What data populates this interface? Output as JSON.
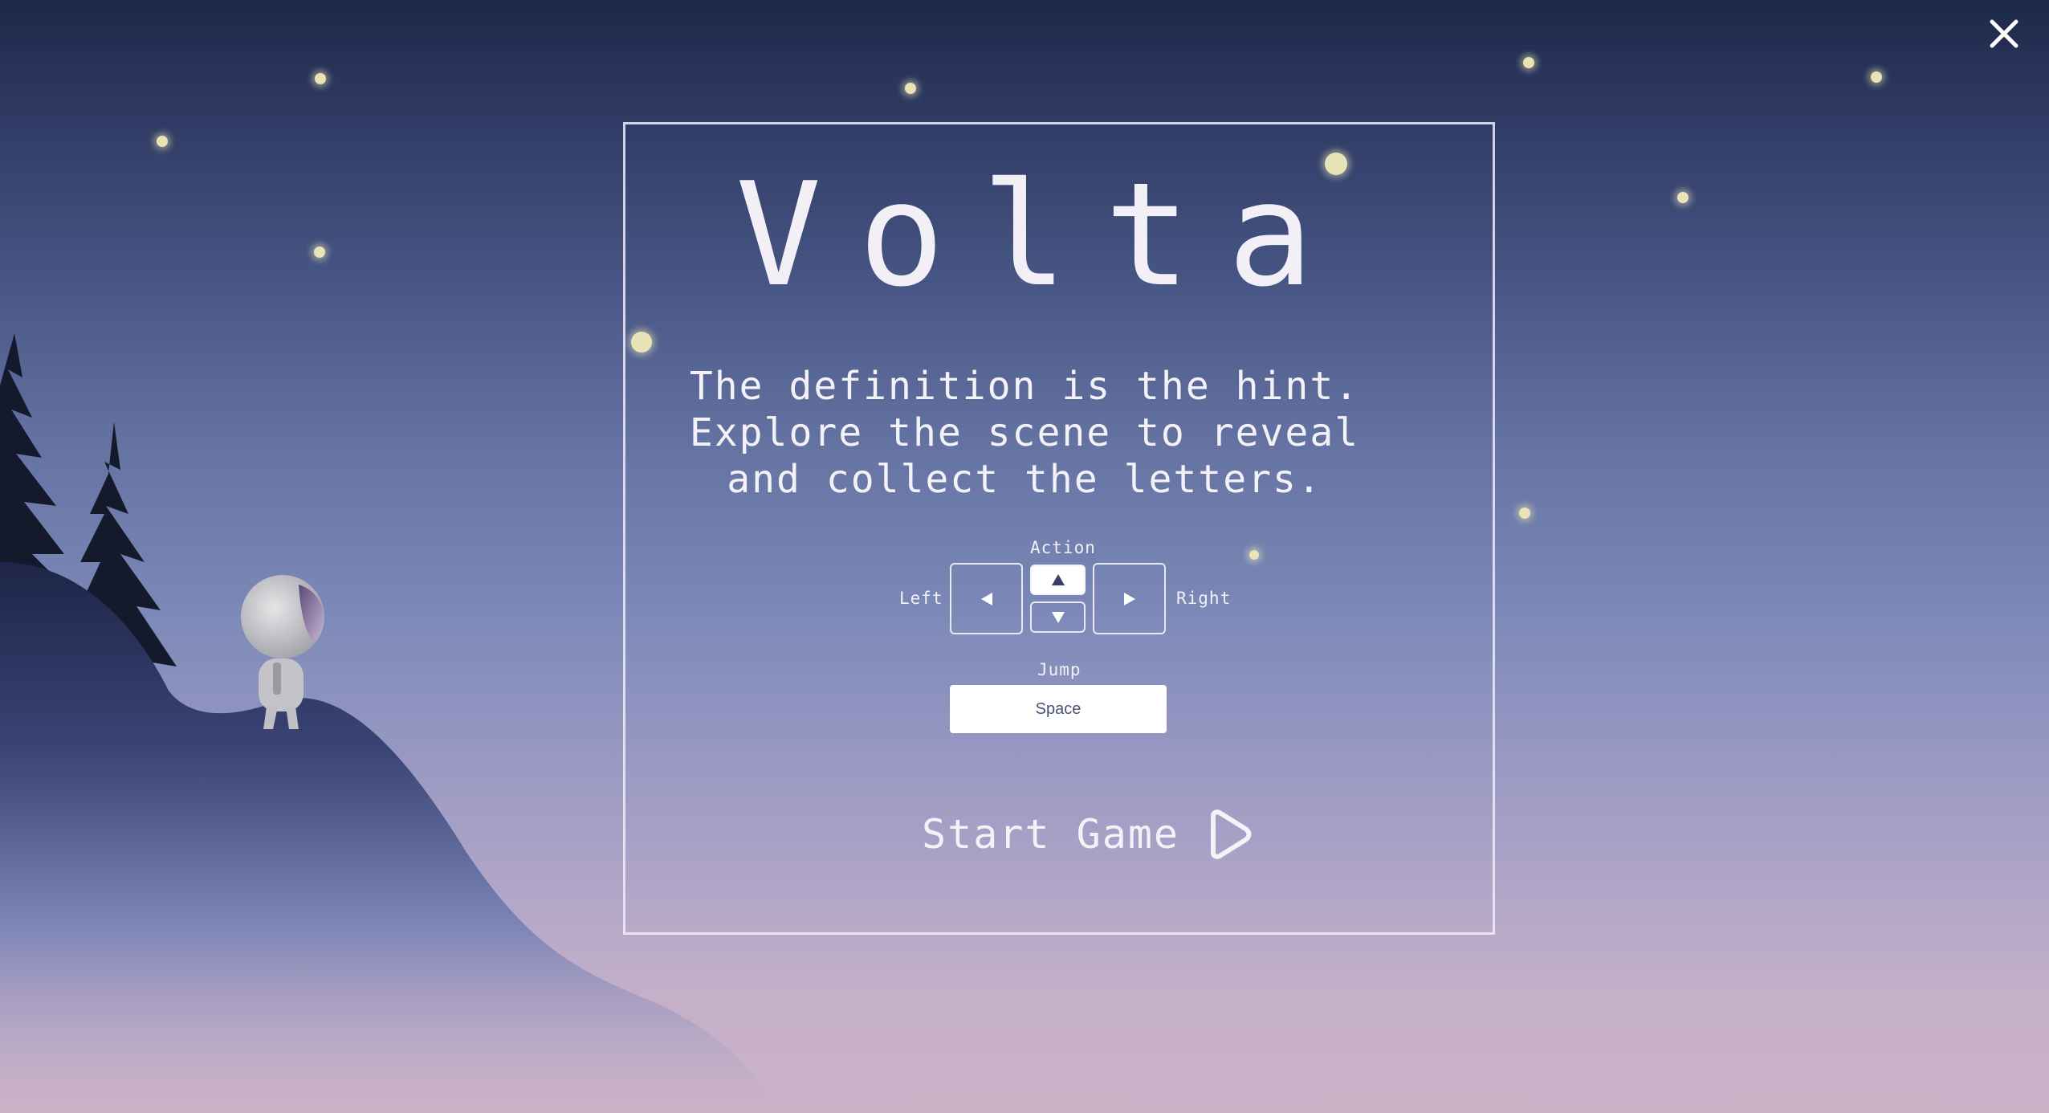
{
  "game": {
    "title": "Volta",
    "hint_lines": [
      "The definition is the hint.",
      "Explore the scene to reveal",
      "and collect the letters."
    ]
  },
  "controls": {
    "action_label": "Action",
    "left_label": "Left",
    "right_label": "Right",
    "jump_label": "Jump",
    "jump_key": "Space"
  },
  "start_label": "Start Game",
  "icons": {
    "close": "close-icon",
    "left": "triangle-left-icon",
    "right": "triangle-right-icon",
    "up": "triangle-up-icon",
    "down": "triangle-down-icon",
    "play": "play-icon"
  },
  "colors": {
    "sky_top": "#1c2848",
    "sky_bottom": "#cdb3c8",
    "hill": "#2a3158",
    "trees": "#141a2c",
    "text": "#f2f0f6"
  }
}
